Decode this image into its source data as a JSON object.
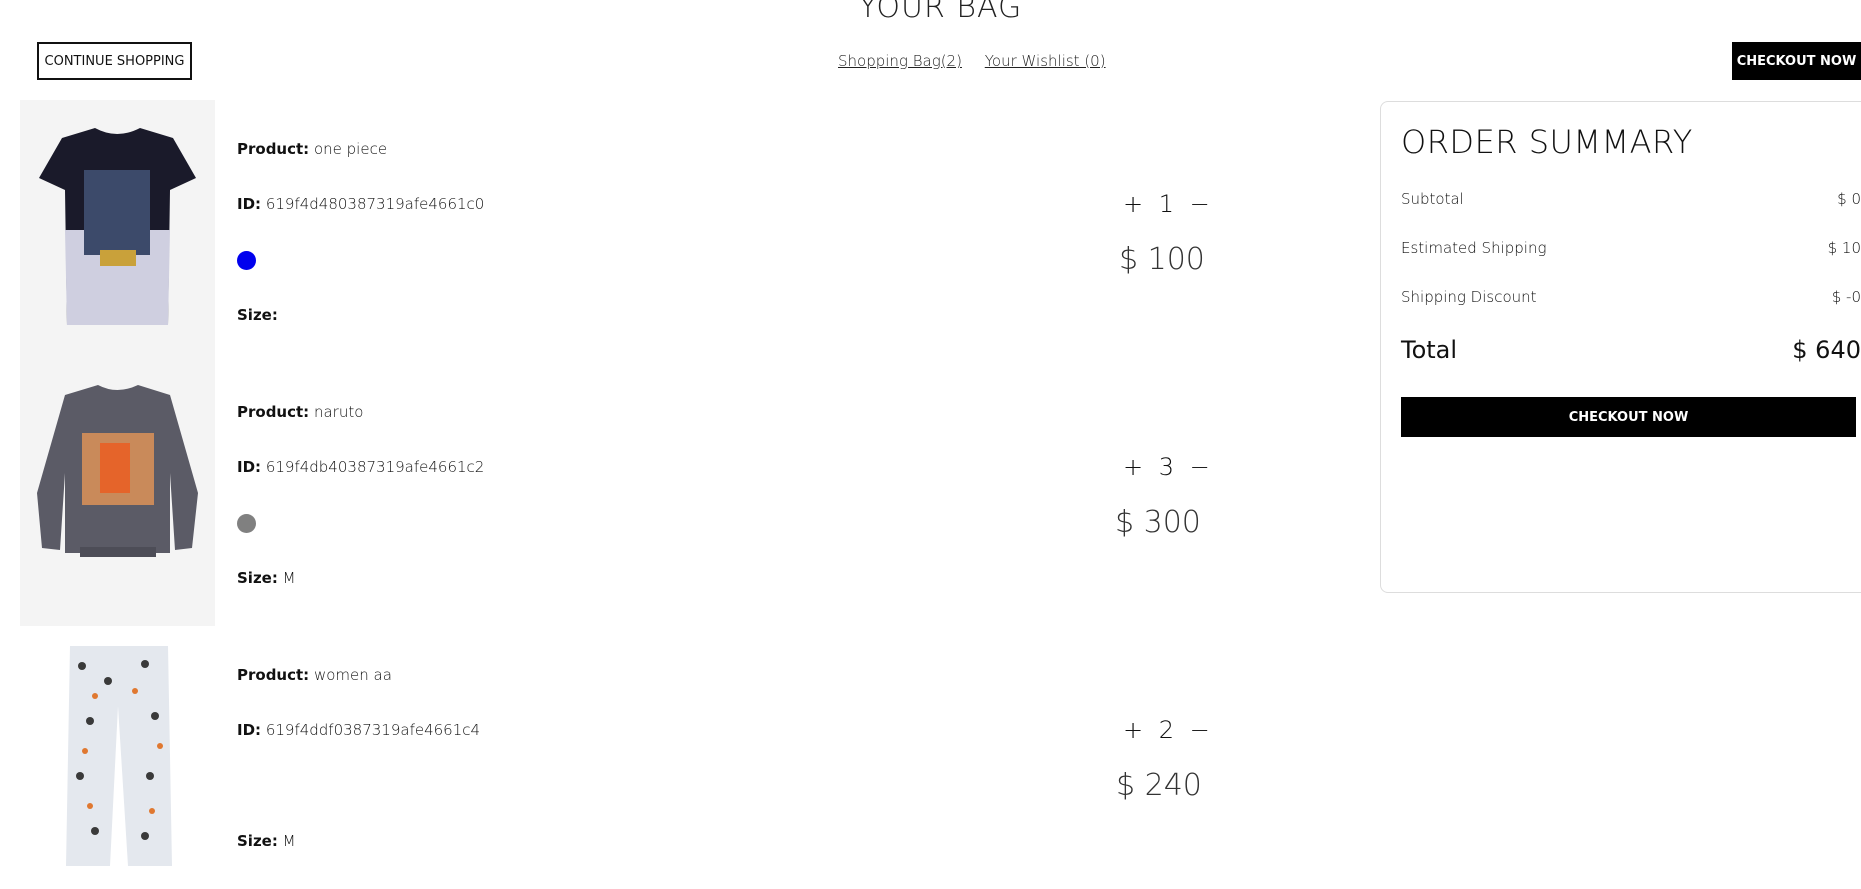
{
  "page": {
    "title": "YOUR BAG"
  },
  "top_bar": {
    "continue_label": "CONTINUE SHOPPING",
    "bag_link": "Shopping Bag(2)",
    "wishlist_link": "Your Wishlist (0)",
    "checkout_label": "CHECKOUT NOW"
  },
  "products": [
    {
      "product_label": "Product:",
      "name": "one piece",
      "id_label": "ID:",
      "id": "619f4d480387319afe4661c0",
      "color": "#0000ee",
      "size_label": "Size:",
      "size": "",
      "quantity": "1",
      "price": "$ 100",
      "image": "star-wars-tshirt-image"
    },
    {
      "product_label": "Product:",
      "name": "naruto",
      "id_label": "ID:",
      "id": "619f4db40387319afe4661c2",
      "color": "#808080",
      "size_label": "Size:",
      "size": "M",
      "quantity": "3",
      "price": "$ 300",
      "image": "naruto-sweatshirt-image"
    },
    {
      "product_label": "Product:",
      "name": "women aa",
      "id_label": "ID:",
      "id": "619f4ddf0387319afe4661c4",
      "color": "",
      "size_label": "Size:",
      "size": "M",
      "quantity": "2",
      "price": "$ 240",
      "image": "printed-pants-image"
    }
  ],
  "summary": {
    "title": "ORDER SUMMARY",
    "subtotal_label": "Subtotal",
    "subtotal": "$ 0",
    "shipping_label": "Estimated Shipping",
    "shipping": "$ 10",
    "discount_label": "Shipping Discount",
    "discount": "$ -0",
    "total_label": "Total",
    "total": "$ 640",
    "checkout_label": "CHECKOUT NOW"
  },
  "qty_controls": {
    "plus": "+",
    "minus": "−"
  }
}
